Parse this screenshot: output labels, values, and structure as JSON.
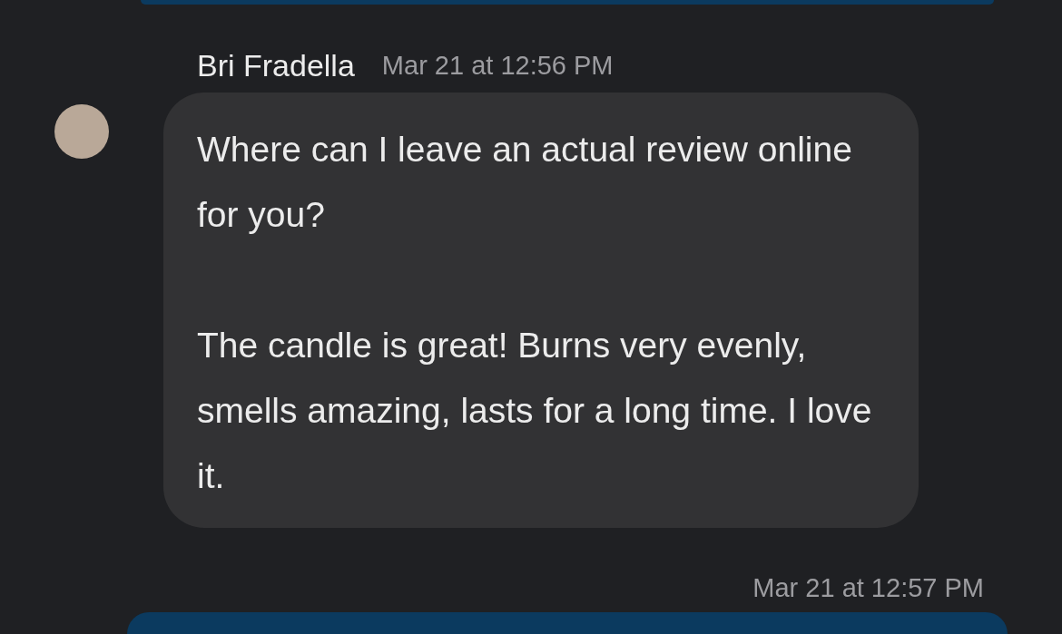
{
  "message": {
    "sender": "Bri Fradella",
    "time": "Mar 21 at 12:56 PM",
    "paragraphs": [
      "Where can I leave an actual review online for you?",
      "The candle is great! Burns very evenly, smells amazing, lasts for a long time. I love it."
    ]
  },
  "next_timestamp": "Mar 21 at 12:57 PM"
}
